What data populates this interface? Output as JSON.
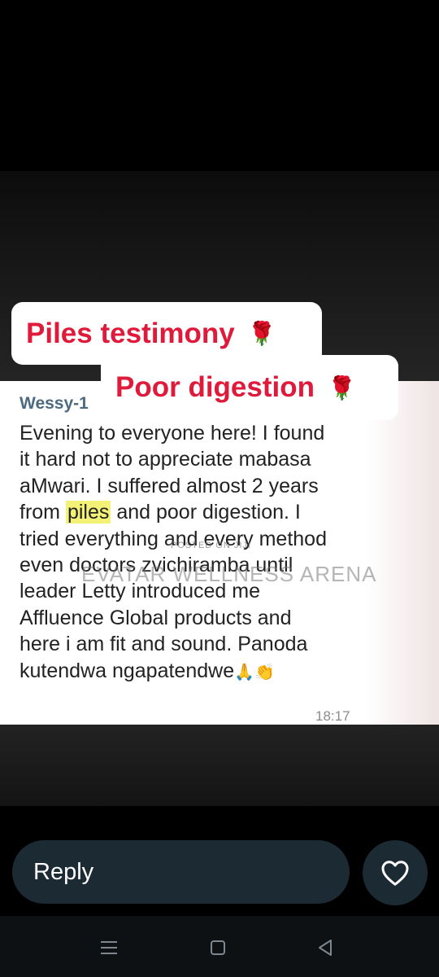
{
  "overlay_labels": [
    {
      "text": "Piles testimony",
      "emoji": "🌹"
    },
    {
      "text": "Poor digestion",
      "emoji": "🌹"
    }
  ],
  "chat": {
    "sender": "Wessy-1",
    "message_lines": [
      "Evening to everyone here! I found",
      "it hard not to appreciate mabasa",
      "aMwari. I suffered almost 2 years",
      [
        "from ",
        "piles",
        " and poor digestion. I"
      ],
      "tried everything and every method",
      "even doctors zvichiramba until",
      "leader Letty introduced me",
      "Affluence Global products and",
      "here i am fit and sound. Panoda",
      "kutendwa ngapatendwe"
    ],
    "message_emojis": "🙏👏",
    "timestamp": "18:17"
  },
  "watermark": {
    "small": "POSTED ON JIJI",
    "main": "EVATAR WELLNESS ARENA"
  },
  "reply_bar": {
    "reply_label": "Reply"
  },
  "icons": {
    "like": "heart-icon",
    "nav_recents": "recents-icon",
    "nav_home": "home-icon",
    "nav_back": "back-icon"
  },
  "colors": {
    "label_text": "#e01a3a",
    "sender_name": "#4c6a80",
    "highlight": "#f4f276",
    "reply_bar_bg": "#1c2a34"
  }
}
